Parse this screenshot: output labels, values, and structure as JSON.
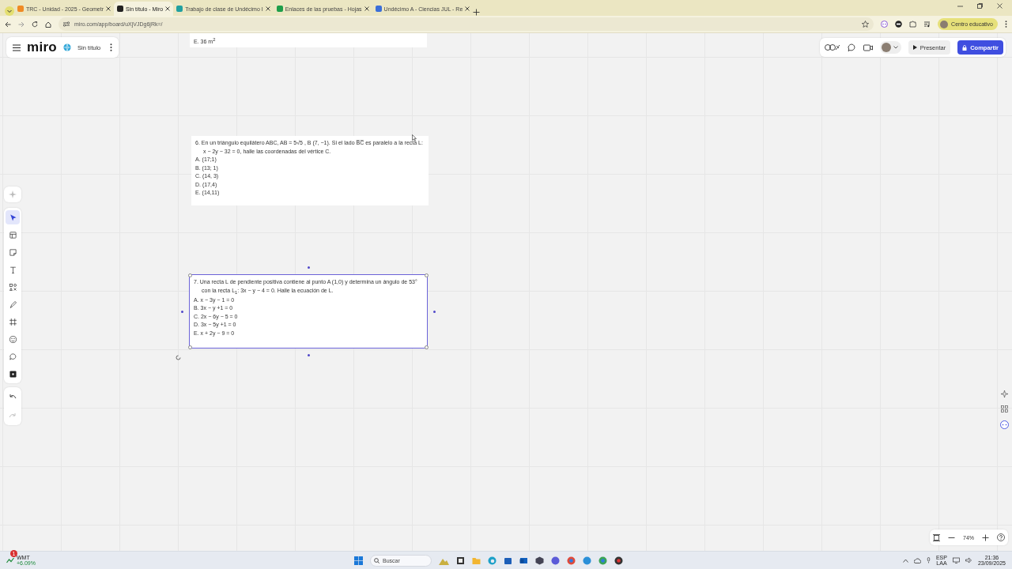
{
  "browser": {
    "tabs": [
      {
        "title": "TRC - Unidad - 2025 - Geometr",
        "selected": false,
        "color": "#f08a24"
      },
      {
        "title": "Sin título - Miro",
        "selected": true,
        "color": "#222222"
      },
      {
        "title": "Trabajo de clase de Undécimo I",
        "selected": false,
        "color": "#21a0a0"
      },
      {
        "title": "Enlaces de las pruebas - Hojas",
        "selected": false,
        "color": "#1e9e4a"
      },
      {
        "title": "Undécimo A - Ciencias JUL - Re",
        "selected": false,
        "color": "#3b6fd8"
      }
    ],
    "url": "miro.com/app/board/uXjVJDg6jRk=/",
    "profile": "Centro educativo"
  },
  "board": {
    "logo": "miro",
    "title": "Sin título",
    "present_button": "Presentar",
    "share_button": "Compartir",
    "tools": [
      {
        "kind": "select",
        "selected": true
      },
      {
        "kind": "templates",
        "selected": false
      },
      {
        "kind": "sticky",
        "selected": false
      },
      {
        "kind": "text",
        "selected": false
      },
      {
        "kind": "shapes",
        "selected": false
      },
      {
        "kind": "pen",
        "selected": false
      },
      {
        "kind": "frame",
        "selected": false
      },
      {
        "kind": "stickers",
        "selected": false
      },
      {
        "kind": "comment",
        "selected": false
      },
      {
        "kind": "apps",
        "selected": false
      }
    ],
    "cards": [
      {
        "options": [
          "E. 36 m$^{2}$"
        ],
        "selected": false
      },
      {
        "question": "6. En un triángulo equilátero ABC, AB = 5√5 , B (7, −1). Si el lado B̅C̅  es paralelo a la recta L: x − 2y − 32 = 0, halle las coordenadas del vértice C.",
        "options": [
          "A. (17;1)",
          "B. (13; 1)",
          "C. (14, 3)",
          "D. (17,4)",
          "E. (14,11)"
        ],
        "selected": false
      },
      {
        "question": "7.  Una recta L de pendiente positiva contiene al punto A (1,0) y determina un ángulo de 53° con la recta L$_{1}$: 3x − y − 4 = 0. Halle la ecuación de L.",
        "options": [
          "A. x − 3y − 1 = 0",
          "B. 3x − y +1 = 0",
          "C. 2x − 6y − 5 = 0",
          "D. 3x − 5y +1 = 0",
          "E. x + 2y − 9 = 0"
        ],
        "selected": true
      }
    ],
    "zoom": "74%"
  },
  "taskbar": {
    "ticker": "WMT",
    "change": "+6.09%",
    "badge": "1",
    "search_placeholder": "Buscar",
    "lang": "ESP",
    "layout": "LAA",
    "time": "21:36",
    "date": "23/09/2025"
  }
}
